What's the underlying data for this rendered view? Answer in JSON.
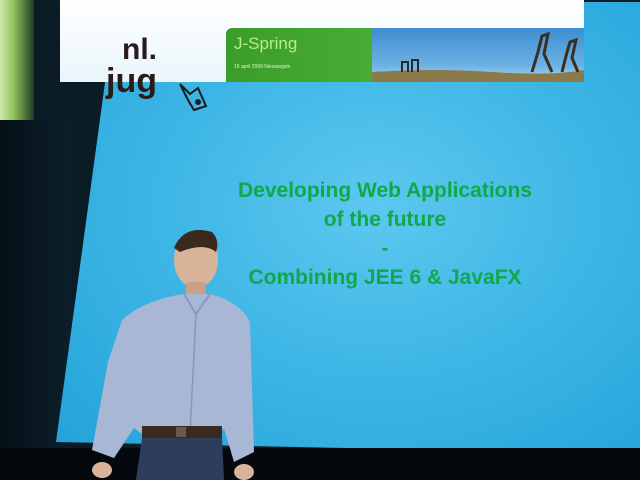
{
  "slide": {
    "logo": {
      "line1": "nl.",
      "line2": "jug"
    },
    "banner": {
      "title": "J-Spring",
      "date": "15 april 2009 Nieuwegein"
    },
    "lines": [
      "Developing Web Applications",
      "of the future",
      "-",
      "Combining JEE 6 & JavaFX"
    ]
  },
  "colors": {
    "screen": "#3fb7e6",
    "slide_text": "#11a84a",
    "banner_green": "#48ac33",
    "shirt": "#a9b7d6"
  }
}
